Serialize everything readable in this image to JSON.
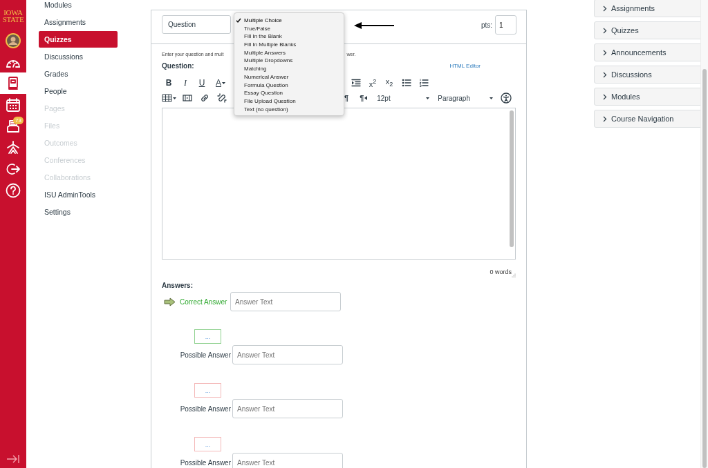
{
  "global_nav": {
    "logo": [
      "IOWA",
      "STATE"
    ],
    "items": [
      {
        "kind": "avatar",
        "selected": false
      },
      {
        "kind": "dashboard",
        "selected": false
      },
      {
        "kind": "courses",
        "selected": true
      },
      {
        "kind": "calendar",
        "selected": false
      },
      {
        "kind": "inbox",
        "selected": false,
        "badge": "73"
      },
      {
        "kind": "commons",
        "selected": false
      },
      {
        "kind": "logout",
        "selected": false
      },
      {
        "kind": "help",
        "selected": false
      }
    ]
  },
  "course_nav": {
    "items": [
      {
        "label": "Modules",
        "selected": false,
        "disabled": false
      },
      {
        "label": "Assignments",
        "selected": false,
        "disabled": false
      },
      {
        "label": "Quizzes",
        "selected": true,
        "disabled": false
      },
      {
        "label": "Discussions",
        "selected": false,
        "disabled": false
      },
      {
        "label": "Grades",
        "selected": false,
        "disabled": false
      },
      {
        "label": "People",
        "selected": false,
        "disabled": false
      },
      {
        "label": "Pages",
        "selected": false,
        "disabled": true
      },
      {
        "label": "Files",
        "selected": false,
        "disabled": true
      },
      {
        "label": "Outcomes",
        "selected": false,
        "disabled": true
      },
      {
        "label": "Conferences",
        "selected": false,
        "disabled": true
      },
      {
        "label": "Collaborations",
        "selected": false,
        "disabled": true
      },
      {
        "label": "ISU AdminTools",
        "selected": false,
        "disabled": false
      },
      {
        "label": "Settings",
        "selected": false,
        "disabled": false
      }
    ]
  },
  "question": {
    "name_value": "Question",
    "type_menu": {
      "options": [
        {
          "label": "Multiple Choice",
          "selected": true
        },
        {
          "label": "True/False",
          "selected": false
        },
        {
          "label": "Fill In the Blank",
          "selected": false
        },
        {
          "label": "Fill In Multiple Blanks",
          "selected": false
        },
        {
          "label": "Multiple Answers",
          "selected": false
        },
        {
          "label": "Multiple Dropdowns",
          "selected": false
        },
        {
          "label": "Matching",
          "selected": false
        },
        {
          "label": "Numerical Answer",
          "selected": false
        },
        {
          "label": "Formula Question",
          "selected": false
        },
        {
          "label": "Essay Question",
          "selected": false
        },
        {
          "label": "File Upload Question",
          "selected": false
        },
        {
          "label": "Text (no question)",
          "selected": false
        }
      ]
    },
    "points": {
      "label": "pts:",
      "value": "1"
    },
    "help_text": [
      "Enter your question and mult",
      "wer."
    ],
    "label": "Question:",
    "html_editor": "HTML Editor",
    "toolbar": {
      "row1_left": [
        {
          "kind": "bold",
          "text": "B"
        },
        {
          "kind": "italic",
          "text": "I"
        },
        {
          "kind": "underline",
          "text": "U"
        },
        {
          "kind": "color",
          "text": "A"
        }
      ],
      "row1_right": [
        {
          "kind": "indent"
        },
        {
          "kind": "superscript",
          "text": "x$^{2}$"
        },
        {
          "kind": "subscript",
          "text": "x$_{2}$"
        },
        {
          "kind": "bullets"
        },
        {
          "kind": "numbers"
        }
      ],
      "row2_left": [
        {
          "kind": "table"
        },
        {
          "kind": "media"
        },
        {
          "kind": "link"
        },
        {
          "kind": "unlink"
        }
      ],
      "row2_right": [
        {
          "kind": "ltr",
          "text": "¶"
        },
        {
          "kind": "rtl",
          "text": "¶"
        },
        {
          "kind": "select",
          "text": "12pt"
        },
        {
          "kind": "select",
          "text": "Paragraph"
        },
        {
          "kind": "accessibility"
        }
      ]
    },
    "word_count": "0 words",
    "answers": {
      "label": "Answers:",
      "rows": [
        {
          "kind": "correct",
          "label": "Correct Answer",
          "placeholder": "Answer Text",
          "comment": "..."
        },
        {
          "kind": "possible",
          "label": "Possible Answer",
          "placeholder": "Answer Text",
          "comment": "..."
        },
        {
          "kind": "possible",
          "label": "Possible Answer",
          "placeholder": "Answer Text",
          "comment": "..."
        },
        {
          "kind": "possible",
          "label": "Possible Answer",
          "placeholder": "Answer Text"
        }
      ]
    }
  },
  "right_sidebar": {
    "sections": [
      "Assignments",
      "Quizzes",
      "Announcements",
      "Discussions",
      "Modules",
      "Course Navigation"
    ]
  }
}
